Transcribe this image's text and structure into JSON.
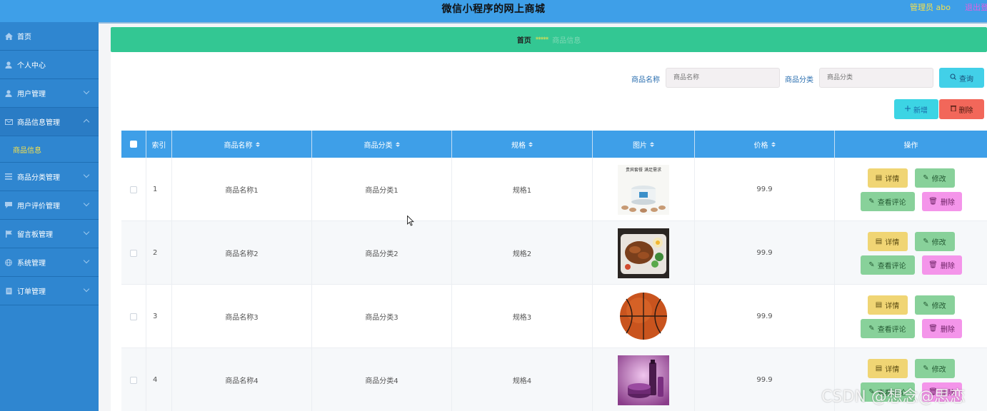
{
  "header": {
    "title": "微信小程序的网上商城",
    "admin_label": "管理员 abo",
    "logout_label": "退出登"
  },
  "sidebar": {
    "items": [
      {
        "label": "首页",
        "icon": "home-icon"
      },
      {
        "label": "个人中心",
        "icon": "user-icon"
      },
      {
        "label": "用户管理",
        "icon": "user-icon"
      },
      {
        "label": "商品信息管理",
        "icon": "mail-icon",
        "expanded": true,
        "children": [
          {
            "label": "商品信息"
          }
        ]
      },
      {
        "label": "商品分类管理",
        "icon": "list-icon"
      },
      {
        "label": "用户评价管理",
        "icon": "comment-icon"
      },
      {
        "label": "留言板管理",
        "icon": "flag-icon"
      },
      {
        "label": "系统管理",
        "icon": "globe-icon"
      },
      {
        "label": "订单管理",
        "icon": "doc-icon"
      }
    ]
  },
  "breadcrumb": {
    "home": "首页",
    "separator": "*****",
    "current": "商品信息"
  },
  "search": {
    "name_label": "商品名称",
    "name_placeholder": "商品名称",
    "category_label": "商品分类",
    "category_placeholder": "商品分类",
    "search_button": "查询"
  },
  "actions": {
    "add_button": "新增",
    "delete_button": "删除"
  },
  "table": {
    "headers": [
      "索引",
      "商品名称",
      "商品分类",
      "规格",
      "图片",
      "价格",
      "操作"
    ],
    "rows": [
      {
        "index": "1",
        "name": "商品名称1",
        "category": "商品分类1",
        "spec": "规格1",
        "image": "rice-cooker-image",
        "price": "99.9"
      },
      {
        "index": "2",
        "name": "商品名称2",
        "category": "商品分类2",
        "spec": "规格2",
        "image": "bento-image",
        "price": "99.9"
      },
      {
        "index": "3",
        "name": "商品名称3",
        "category": "商品分类3",
        "spec": "规格3",
        "image": "basketball-image",
        "price": "99.9"
      },
      {
        "index": "4",
        "name": "商品名称4",
        "category": "商品分类4",
        "spec": "规格4",
        "image": "cosmetics-image",
        "price": "99.9"
      }
    ],
    "row_actions": {
      "detail": "详情",
      "edit": "修改",
      "review": "查看评论",
      "remove": "删除"
    }
  },
  "watermark": "CSDN @想念@思恋",
  "colors": {
    "header_bg": "#3e9fe8",
    "sidebar_bg": "#2f86d0",
    "breadcrumb_bg": "#33c793",
    "accent_yellow": "#f4e04d"
  }
}
